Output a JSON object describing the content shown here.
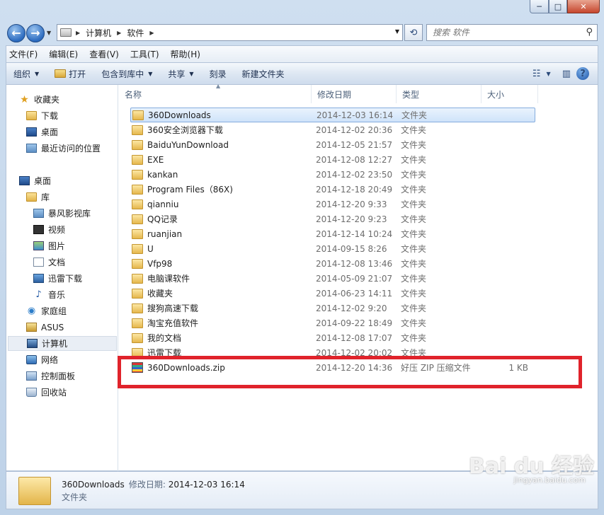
{
  "window": {
    "min": "─",
    "max": "□",
    "close": "✕"
  },
  "nav": {
    "back": "←",
    "forward": "→"
  },
  "address": {
    "parts": [
      "计算机",
      "软件"
    ]
  },
  "search": {
    "placeholder": "搜索 软件"
  },
  "menu": [
    "文件(F)",
    "编辑(E)",
    "查看(V)",
    "工具(T)",
    "帮助(H)"
  ],
  "toolbar": {
    "organize": "组织",
    "open": "打开",
    "include": "包含到库中",
    "share": "共享",
    "burn": "刻录",
    "new_folder": "新建文件夹"
  },
  "sidebar": [
    {
      "label": "收藏夹",
      "icon": "star-icon"
    },
    {
      "label": "下载",
      "icon": "download-folder-icon"
    },
    {
      "label": "桌面",
      "icon": "desktop-icon"
    },
    {
      "label": "最近访问的位置",
      "icon": "recent-places-icon"
    },
    {
      "label": "桌面",
      "icon": "desktop-icon"
    },
    {
      "label": "库",
      "icon": "library-icon"
    },
    {
      "label": "暴风影视库",
      "icon": "video-library-icon"
    },
    {
      "label": "视频",
      "icon": "video-icon"
    },
    {
      "label": "图片",
      "icon": "picture-icon"
    },
    {
      "label": "文档",
      "icon": "document-icon"
    },
    {
      "label": "迅雷下载",
      "icon": "thunder-download-icon"
    },
    {
      "label": "音乐",
      "icon": "music-icon"
    },
    {
      "label": "家庭组",
      "icon": "homegroup-icon"
    },
    {
      "label": "ASUS",
      "icon": "user-folder-icon"
    },
    {
      "label": "计算机",
      "icon": "computer-icon"
    },
    {
      "label": "网络",
      "icon": "network-icon"
    },
    {
      "label": "控制面板",
      "icon": "control-panel-icon"
    },
    {
      "label": "回收站",
      "icon": "recycle-bin-icon"
    }
  ],
  "columns": {
    "name": "名称",
    "date": "修改日期",
    "type": "类型",
    "size": "大小"
  },
  "files": [
    {
      "name": "360Downloads",
      "date": "2014-12-03 16:14",
      "type": "文件夹",
      "size": ""
    },
    {
      "name": "360安全浏览器下载",
      "date": "2014-12-02 20:36",
      "type": "文件夹",
      "size": ""
    },
    {
      "name": "BaiduYunDownload",
      "date": "2014-12-05 21:57",
      "type": "文件夹",
      "size": ""
    },
    {
      "name": "EXE",
      "date": "2014-12-08 12:27",
      "type": "文件夹",
      "size": ""
    },
    {
      "name": "kankan",
      "date": "2014-12-02 23:50",
      "type": "文件夹",
      "size": ""
    },
    {
      "name": "Program Files（86X)",
      "date": "2014-12-18 20:49",
      "type": "文件夹",
      "size": ""
    },
    {
      "name": "qianniu",
      "date": "2014-12-20 9:33",
      "type": "文件夹",
      "size": ""
    },
    {
      "name": "QQ记录",
      "date": "2014-12-20 9:23",
      "type": "文件夹",
      "size": ""
    },
    {
      "name": "ruanjian",
      "date": "2014-12-14 10:24",
      "type": "文件夹",
      "size": ""
    },
    {
      "name": "U",
      "date": "2014-09-15 8:26",
      "type": "文件夹",
      "size": ""
    },
    {
      "name": "Vfp98",
      "date": "2014-12-08 13:46",
      "type": "文件夹",
      "size": ""
    },
    {
      "name": "电脑课软件",
      "date": "2014-05-09 21:07",
      "type": "文件夹",
      "size": ""
    },
    {
      "name": "收藏夹",
      "date": "2014-06-23 14:11",
      "type": "文件夹",
      "size": ""
    },
    {
      "name": "搜狗高速下载",
      "date": "2014-12-02 9:20",
      "type": "文件夹",
      "size": ""
    },
    {
      "name": "淘宝充值软件",
      "date": "2014-09-22 18:49",
      "type": "文件夹",
      "size": ""
    },
    {
      "name": "我的文档",
      "date": "2014-12-08 17:07",
      "type": "文件夹",
      "size": ""
    },
    {
      "name": "迅雷下载",
      "date": "2014-12-02 20:02",
      "type": "文件夹",
      "size": ""
    },
    {
      "name": "360Downloads.zip",
      "date": "2014-12-20 14:36",
      "type": "好压 ZIP 压缩文件",
      "size": "1 KB"
    }
  ],
  "details": {
    "name": "360Downloads",
    "date_label": "修改日期:",
    "date": "2014-12-03 16:14",
    "type": "文件夹"
  },
  "watermark": {
    "logo": "Bai du 经验",
    "url": "jingyan.baidu.com"
  },
  "colors": {
    "highlight": "#e0232b",
    "selection": "#cfe3fa"
  }
}
